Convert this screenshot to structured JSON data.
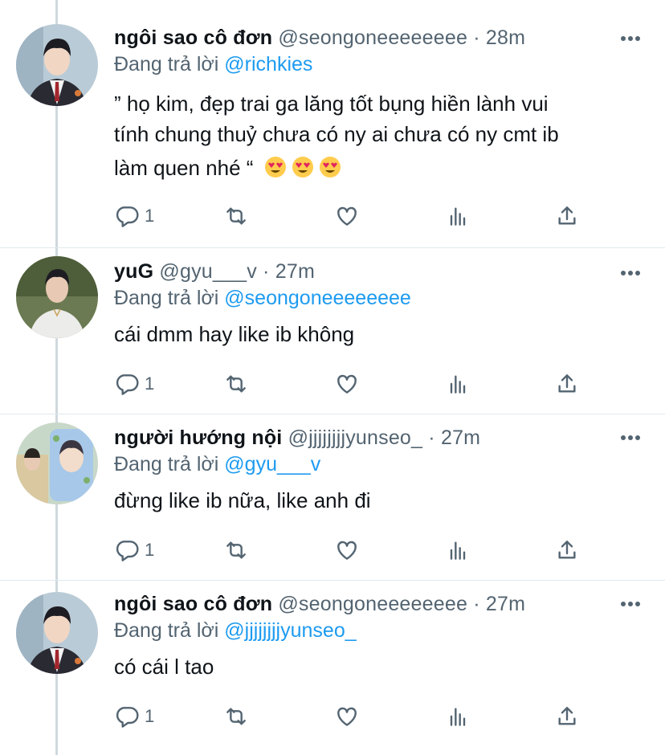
{
  "tweets": [
    {
      "name": "ngôi sao cô đơn",
      "handle": "@seongoneeeeeeee",
      "separator": "·",
      "time": "28m",
      "reply_prefix": "Đang trả lời",
      "reply_to": "@richkies",
      "text_line1": "” họ kim, đẹp trai ga lăng tốt bụng hiền lành vui",
      "text_line2": "tính chung thuỷ chưa có ny ai chưa có ny cmt ib",
      "text_line3": "làm quen nhé “",
      "emojis": [
        "heart-eyes-emoji",
        "heart-eyes-emoji",
        "heart-eyes-emoji"
      ],
      "reply_count": "1"
    },
    {
      "name": "yuG",
      "handle": "@gyu___v",
      "separator": "·",
      "time": "27m",
      "reply_prefix": "Đang trả lời",
      "reply_to": "@seongoneeeeeeee",
      "text_line1": "cái dmm hay like ib không",
      "reply_count": "1"
    },
    {
      "name": "người hướng nội",
      "handle": "@jjjjjjjjyunseo_",
      "separator": "·",
      "time": "27m",
      "reply_prefix": "Đang trả lời",
      "reply_to": "@gyu___v",
      "text_line1": "đừng like ib nữa, like anh đi",
      "reply_count": "1"
    },
    {
      "name": "ngôi sao cô đơn",
      "handle": "@seongoneeeeeeee",
      "separator": "·",
      "time": "27m",
      "reply_prefix": "Đang trả lời",
      "reply_to": "@jjjjjjjjyunseo_",
      "text_line1": "có cái l tao",
      "reply_count": "1"
    }
  ],
  "icons": {
    "reply": "reply-icon",
    "retweet": "retweet-icon",
    "like": "like-icon",
    "analytics": "analytics-icon",
    "share": "share-icon",
    "more": "more-icon"
  },
  "colors": {
    "mention": "#1d9bf0",
    "secondary_text": "#536471",
    "primary_text": "#0f1419",
    "thread_line": "#cfd9de"
  }
}
